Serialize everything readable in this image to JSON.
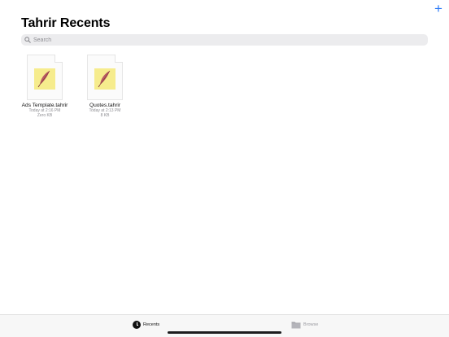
{
  "header": {
    "title": "Tahrir Recents",
    "add_label": "+"
  },
  "search": {
    "placeholder": "Search"
  },
  "files": [
    {
      "name": "Ads Template.tahrir",
      "date": "Today at 2:16 PM",
      "size": "Zero KB"
    },
    {
      "name": "Quotes.tahrir",
      "date": "Today at 2:13 PM",
      "size": "8 KB"
    }
  ],
  "tabbar": {
    "recents_label": "Recents",
    "browse_label": "Browse"
  },
  "colors": {
    "accent": "#2f7bf6",
    "note_yellow": "#f6ec8d"
  },
  "icons": [
    "plus-icon",
    "search-icon",
    "feather-icon",
    "clock-icon",
    "folder-icon"
  ]
}
